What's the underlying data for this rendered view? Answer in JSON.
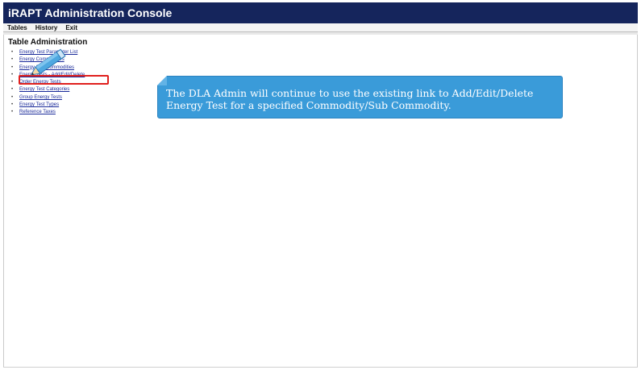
{
  "app": {
    "title": "iRAPT Administration Console"
  },
  "menu": {
    "items": [
      "Tables",
      "History",
      "Exit"
    ]
  },
  "section": {
    "title": "Table Administration"
  },
  "links": [
    "Energy Test Parameter List",
    "Energy Commodities",
    "Energy Sub Commodities",
    "Energy Tests - Add/Edit/Delete",
    "Order Energy Tests",
    "Energy Test Categories",
    "Group Energy Tests",
    "Energy Test Types",
    "Reference Taxes"
  ],
  "callout": {
    "text": "The DLA Admin will continue to use the existing link to Add/Edit/Delete Energy Test for a specified Commodity/Sub Commodity."
  },
  "colors": {
    "titlebar": "#15255c",
    "link": "#1a2a9a",
    "highlight": "#e0201e",
    "callout": "#3a9bd9"
  },
  "icons": {
    "pointer": "pencil-icon"
  }
}
